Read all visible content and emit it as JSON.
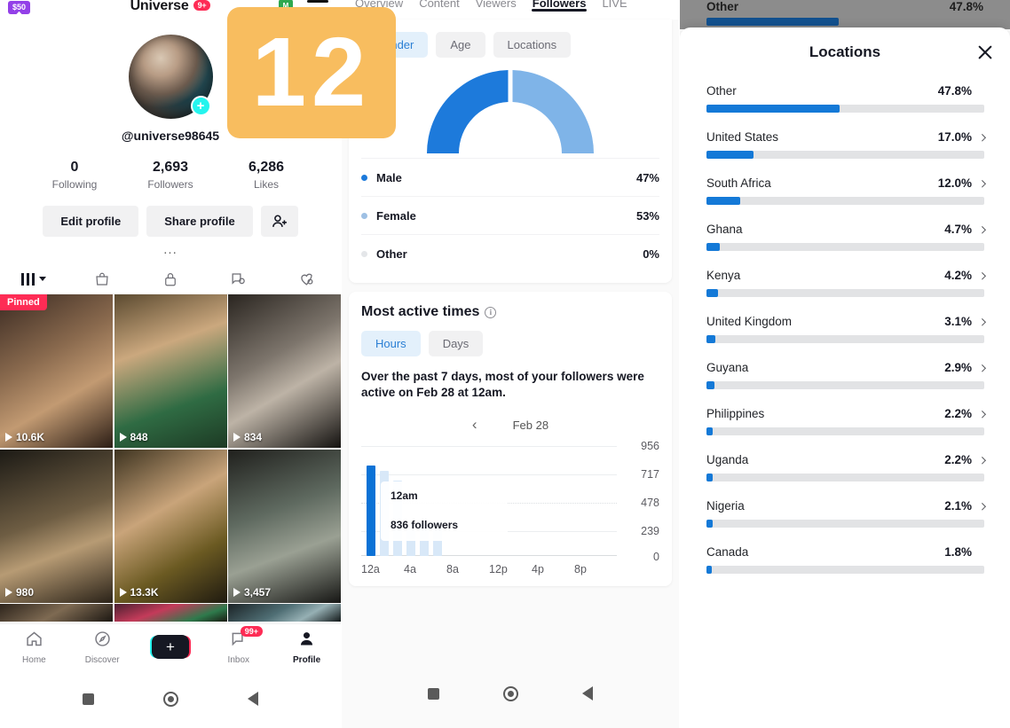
{
  "profile": {
    "money_badge": "$50",
    "app_title": "Universe",
    "notif_badge": "9+",
    "green_badge": "M",
    "handle": "@universe98645",
    "stats": [
      {
        "num": "0",
        "label": "Following"
      },
      {
        "num": "2,693",
        "label": "Followers"
      },
      {
        "num": "6,286",
        "label": "Likes"
      }
    ],
    "edit_profile": "Edit profile",
    "share_profile": "Share profile",
    "more_dots": "...",
    "videos": [
      {
        "views": "10.6K",
        "pinned": "Pinned"
      },
      {
        "views": "848",
        "pinned": ""
      },
      {
        "views": "834",
        "pinned": ""
      },
      {
        "views": "980",
        "pinned": ""
      },
      {
        "views": "13.3K",
        "pinned": ""
      },
      {
        "views": "3,457",
        "pinned": ""
      }
    ],
    "nav": [
      {
        "label": "Home",
        "badge": ""
      },
      {
        "label": "Discover",
        "badge": ""
      },
      {
        "label": "",
        "badge": ""
      },
      {
        "label": "Inbox",
        "badge": "99+"
      },
      {
        "label": "Profile",
        "badge": ""
      }
    ]
  },
  "analytics": {
    "tabs": [
      "Overview",
      "Content",
      "Viewers",
      "Followers",
      "LIVE"
    ],
    "active_tab": "Followers",
    "subtabs": [
      "Gender",
      "Age",
      "Locations"
    ],
    "active_subtab": "Gender",
    "gender": {
      "rows": [
        {
          "label": "Male",
          "value": "47%"
        },
        {
          "label": "Female",
          "value": "53%"
        },
        {
          "label": "Other",
          "value": "0%"
        }
      ]
    },
    "most_active": {
      "title": "Most active times",
      "toggle": [
        "Hours",
        "Days"
      ],
      "active_toggle": "Hours",
      "hint": "Over the past 7 days, most of your followers were active on Feb 28 at 12am.",
      "date": "Feb 28",
      "tooltip_time": "12am",
      "tooltip_value": "836 followers"
    }
  },
  "overlay_badge": "12",
  "locations": {
    "behind_row": {
      "name": "Other",
      "pct": "47.8%"
    },
    "title": "Locations",
    "items": [
      {
        "name": "Other",
        "pct": "47.8%",
        "value": 47.8,
        "chevron": false
      },
      {
        "name": "United States",
        "pct": "17.0%",
        "value": 17.0,
        "chevron": true
      },
      {
        "name": "South Africa",
        "pct": "12.0%",
        "value": 12.0,
        "chevron": true
      },
      {
        "name": "Ghana",
        "pct": "4.7%",
        "value": 4.7,
        "chevron": true
      },
      {
        "name": "Kenya",
        "pct": "4.2%",
        "value": 4.2,
        "chevron": true
      },
      {
        "name": "United Kingdom",
        "pct": "3.1%",
        "value": 3.1,
        "chevron": true
      },
      {
        "name": "Guyana",
        "pct": "2.9%",
        "value": 2.9,
        "chevron": true
      },
      {
        "name": "Philippines",
        "pct": "2.2%",
        "value": 2.2,
        "chevron": true
      },
      {
        "name": "Uganda",
        "pct": "2.2%",
        "value": 2.2,
        "chevron": true
      },
      {
        "name": "Nigeria",
        "pct": "2.1%",
        "value": 2.1,
        "chevron": true
      },
      {
        "name": "Canada",
        "pct": "1.8%",
        "value": 1.8,
        "chevron": false
      }
    ]
  },
  "colors": {
    "brand_red": "#fe2c55",
    "brand_cyan": "#25f4ee",
    "accent_blue": "#1479d7",
    "male_blue": "#1d7adb",
    "female_blue": "#7fb4e8",
    "other_gray": "#e4e6e9",
    "overlay_orange": "#f8bd5f"
  },
  "chart_data": [
    {
      "type": "pie",
      "title": "Gender",
      "labels": [
        "Male",
        "Female",
        "Other"
      ],
      "values": [
        47,
        53,
        0
      ],
      "unit": "%",
      "colors": [
        "#1d7adb",
        "#7fb4e8",
        "#e4e6e9"
      ],
      "legend": "below",
      "note": "half-donut gauge"
    },
    {
      "type": "bar",
      "title": "Most active times",
      "subtitle": "Feb 28",
      "categories": [
        "12a",
        "1a",
        "2a",
        "3a",
        "4a",
        "5a",
        "6a",
        "7a",
        "8a",
        "9a",
        "10a",
        "11a",
        "12p",
        "1p",
        "2p",
        "3p",
        "4p",
        "5p",
        "6p",
        "7p",
        "8p",
        "9p",
        "10p",
        "11p"
      ],
      "values": [
        836,
        790,
        700,
        290,
        290,
        290,
        0,
        0,
        0,
        0,
        0,
        0,
        0,
        0,
        0,
        0,
        0,
        0,
        0,
        0,
        0,
        0,
        0,
        0
      ],
      "tick_labels": [
        "12a",
        "4a",
        "8a",
        "12p",
        "4p",
        "8p"
      ],
      "ylabel": "",
      "xlabel": "",
      "ylim": [
        0,
        956
      ],
      "yticks": [
        0,
        239,
        478,
        717,
        956
      ],
      "grid": true,
      "highlight_index": 0,
      "highlight_label": "12am",
      "highlight_value": "836 followers",
      "bar_color": "#d8e8f8",
      "highlight_color": "#0b72d6"
    },
    {
      "type": "bar",
      "title": "Locations",
      "orientation": "horizontal",
      "categories": [
        "Other",
        "United States",
        "South Africa",
        "Ghana",
        "Kenya",
        "United Kingdom",
        "Guyana",
        "Philippines",
        "Uganda",
        "Nigeria",
        "Canada"
      ],
      "values": [
        47.8,
        17.0,
        12.0,
        4.7,
        4.2,
        3.1,
        2.9,
        2.2,
        2.2,
        2.1,
        1.8
      ],
      "unit": "%",
      "xlim": [
        0,
        100
      ],
      "bar_color": "#1479d7",
      "track_color": "#e2e3e5"
    }
  ]
}
